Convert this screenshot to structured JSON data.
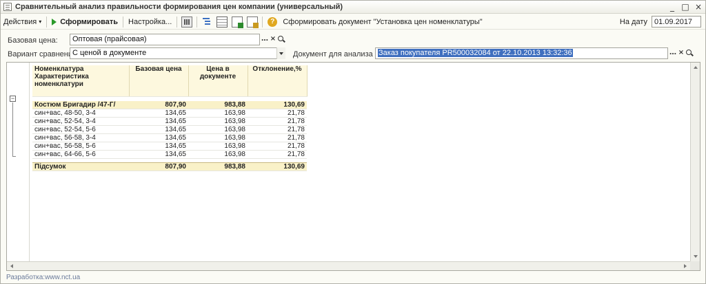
{
  "window": {
    "title": "Сравнительный анализ правильности формирования цен компании (универсальный)",
    "buttons": [
      "_",
      "□",
      "×"
    ]
  },
  "toolbar": {
    "actions_label": "Действия",
    "run_label": "Сформировать",
    "settings_label": "Настройка...",
    "create_doc_label": "Сформировать документ \"Установка цен номенклатуры\"",
    "date_label": "На дату",
    "date_value": "01.09.2017"
  },
  "form": {
    "base_price_label": "Базовая цена:",
    "base_price_value": "Оптовая (прайсовая)",
    "compare_label": "Вариант сравнения:",
    "compare_value": "С ценой в документе",
    "doc_label": "Документ для анализа цен:",
    "doc_value": "Заказ покупателя PR500032084 от 22.10.2013 13:32:36"
  },
  "report": {
    "headers": {
      "nomenclature": "Номенклатура",
      "characteristic_1": "Характеристика",
      "characteristic_2": "номенклатури",
      "base_price": "Базовая цена",
      "doc_price_1": "Цена в",
      "doc_price_2": "документе",
      "deviation": "Отклонение,%"
    },
    "group": {
      "name": "Костюм Бригадир /47-Г/",
      "base": "807,90",
      "doc": "983,88",
      "dev": "130,69"
    },
    "rows": [
      {
        "name": "син+вас, 48-50, 3-4",
        "base": "134,65",
        "doc": "163,98",
        "dev": "21,78"
      },
      {
        "name": "син+вас, 52-54, 3-4",
        "base": "134,65",
        "doc": "163,98",
        "dev": "21,78"
      },
      {
        "name": "син+вас, 52-54, 5-6",
        "base": "134,65",
        "doc": "163,98",
        "dev": "21,78"
      },
      {
        "name": "син+вас, 56-58, 3-4",
        "base": "134,65",
        "doc": "163,98",
        "dev": "21,78"
      },
      {
        "name": "син+вас, 56-58, 5-6",
        "base": "134,65",
        "doc": "163,98",
        "dev": "21,78"
      },
      {
        "name": "син+вас, 64-66, 5-6",
        "base": "134,65",
        "doc": "163,98",
        "dev": "21,78"
      }
    ],
    "total": {
      "name": "Підсумок",
      "base": "807,90",
      "doc": "983,88",
      "dev": "130,69"
    }
  },
  "footer": {
    "developer": "Разработка:www.nct.ua"
  }
}
